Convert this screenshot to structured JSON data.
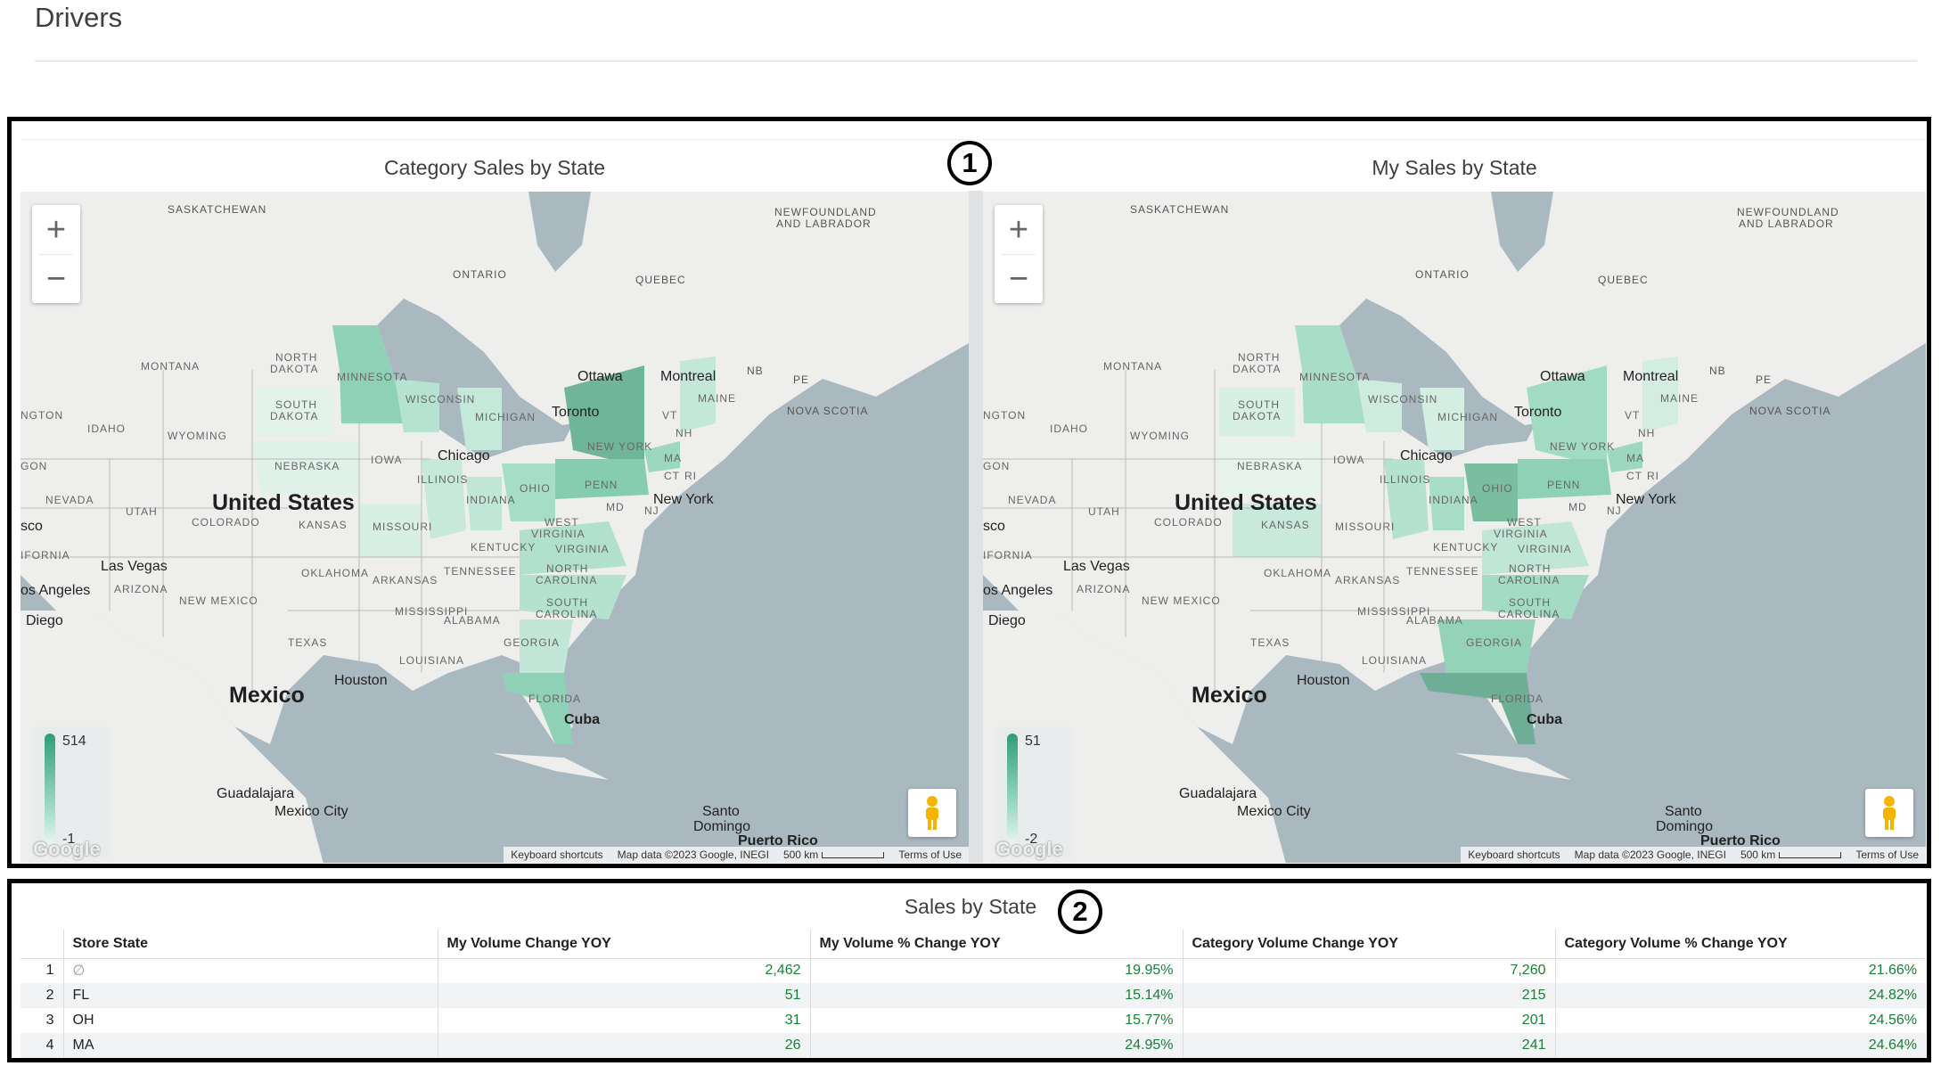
{
  "page": {
    "title": "Drivers"
  },
  "markers": {
    "one": "1",
    "two": "2"
  },
  "maps": [
    {
      "title": "Category Sales by State",
      "legend_max": "514",
      "legend_min": "-1",
      "highlighted_states": [
        "NEW YORK",
        "MINNESOTA",
        "FLORIDA",
        "PENN",
        "OHIO"
      ]
    },
    {
      "title": "My Sales by State",
      "legend_max": "51",
      "legend_min": "-2",
      "highlighted_states": [
        "FLORIDA",
        "OHIO",
        "PENN",
        "MINNESOTA",
        "GEORGIA"
      ]
    }
  ],
  "map_labels": {
    "countries": {
      "us": "United States",
      "mexico": "Mexico",
      "cuba": "Cuba"
    },
    "regions": {
      "saskatchewan": "SASKATCHEWAN",
      "newfoundland1": "NEWFOUNDLAND",
      "newfoundland2": "AND LABRADOR",
      "ontario": "ONTARIO",
      "quebec": "QUEBEC",
      "nb": "NB",
      "pe": "PE",
      "nova_scotia": "NOVA SCOTIA"
    },
    "states": {
      "montana": "MONTANA",
      "north_dakota1": "NORTH",
      "north_dakota2": "DAKOTA",
      "south_dakota1": "SOUTH",
      "south_dakota2": "DAKOTA",
      "minnesota": "MINNESOTA",
      "wisconsin": "WISCONSIN",
      "michigan": "MICHIGAN",
      "idaho": "IDAHO",
      "wyoming": "WYOMING",
      "nebraska": "NEBRASKA",
      "iowa": "IOWA",
      "illinois": "ILLINOIS",
      "indiana": "INDIANA",
      "ohio": "OHIO",
      "penn": "PENN",
      "new_york": "NEW YORK",
      "nevada": "NEVADA",
      "utah": "UTAH",
      "colorado": "COLORADO",
      "kansas": "KANSAS",
      "missouri": "MISSOURI",
      "kentucky": "KENTUCKY",
      "west_virginia1": "WEST",
      "west_virginia2": "VIRGINIA",
      "virginia": "VIRGINIA",
      "oklahoma": "OKLAHOMA",
      "arkansas": "ARKANSAS",
      "tennessee": "TENNESSEE",
      "north_carolina1": "NORTH",
      "north_carolina2": "CAROLINA",
      "south_carolina1": "SOUTH",
      "south_carolina2": "CAROLINA",
      "arizona": "ARIZONA",
      "new_mexico": "NEW MEXICO",
      "texas": "TEXAS",
      "mississippi": "MISSISSIPPI",
      "alabama": "ALABAMA",
      "georgia": "GEORGIA",
      "louisiana": "LOUISIANA",
      "florida": "FLORIDA",
      "maine": "MAINE",
      "vt": "VT",
      "nh": "NH",
      "ma": "MA",
      "ct": "CT",
      "ri": "RI",
      "md": "MD",
      "nj": "NJ",
      "california": "IFORNIA",
      "oregon": "GON",
      "washington": "NGTON"
    },
    "cities": {
      "ottawa": "Ottawa",
      "montreal": "Montreal",
      "toronto": "Toronto",
      "chicago": "Chicago",
      "new_york": "New York",
      "las_vegas": "Las Vegas",
      "los_angeles": "os Angeles",
      "san_diego": "Diego",
      "houston": "Houston",
      "guadalajara": "Guadalajara",
      "mexico_city": "Mexico City",
      "santo_domingo1": "Santo",
      "santo_domingo2": "Domingo",
      "puerto_rico": "Puerto Rico",
      "san_francisco": "sco"
    }
  },
  "map_controls": {
    "zoom_in": "+",
    "zoom_out": "−",
    "google_logo": "Google",
    "keyboard_shortcuts": "Keyboard shortcuts",
    "map_data": "Map data ©2023 Google, INEGI",
    "scale": "500 km",
    "terms": "Terms of Use"
  },
  "table": {
    "title": "Sales by State",
    "headers": [
      "Store State",
      "My Volume Change YOY",
      "My Volume % Change YOY",
      "Category Volume Change YOY",
      "Category Volume % Change YOY"
    ],
    "rows": [
      {
        "index": "1",
        "state": "∅",
        "my_change": "2,462",
        "my_pct": "19.95%",
        "cat_change": "7,260",
        "cat_pct": "21.66%"
      },
      {
        "index": "2",
        "state": "FL",
        "my_change": "51",
        "my_pct": "15.14%",
        "cat_change": "215",
        "cat_pct": "24.82%"
      },
      {
        "index": "3",
        "state": "OH",
        "my_change": "31",
        "my_pct": "15.77%",
        "cat_change": "201",
        "cat_pct": "24.56%"
      },
      {
        "index": "4",
        "state": "MA",
        "my_change": "26",
        "my_pct": "24.95%",
        "cat_change": "241",
        "cat_pct": "24.64%"
      }
    ]
  },
  "colors": {
    "accent_green": "#188038",
    "choropleth_dark": "#2e9e76",
    "choropleth_light": "#b9e6d5",
    "land": "#eeeeec",
    "water": "#aab8c0"
  },
  "icons": {
    "pegman": "pegman-icon",
    "zoom_in": "plus-icon",
    "zoom_out": "minus-icon"
  }
}
